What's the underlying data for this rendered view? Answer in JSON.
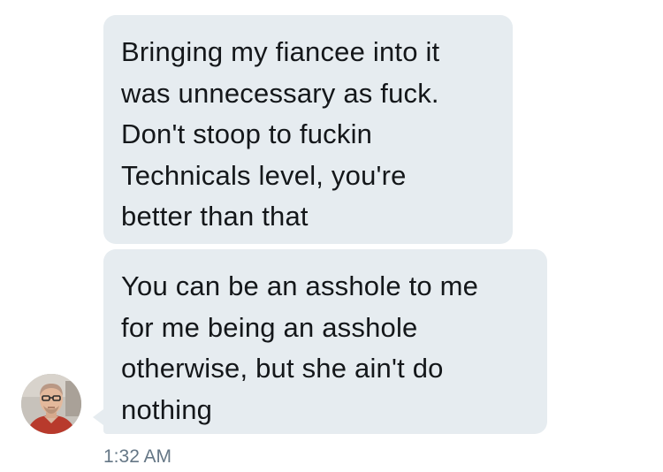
{
  "thread": {
    "messages": [
      {
        "lines": [
          "Bringing my fiancee into it",
          "was unnecessary as fuck.",
          "Don't stoop to fuckin",
          "Technicals level, you're",
          "better than that"
        ]
      },
      {
        "lines": [
          "You can be an asshole to me",
          "for me being an asshole",
          "otherwise, but she ain't do",
          "nothing"
        ]
      }
    ],
    "timestamp": "1:32 AM",
    "colors": {
      "bubble_background": "#e6ecf0",
      "message_text": "#14171a",
      "timestamp_text": "#657786"
    }
  }
}
